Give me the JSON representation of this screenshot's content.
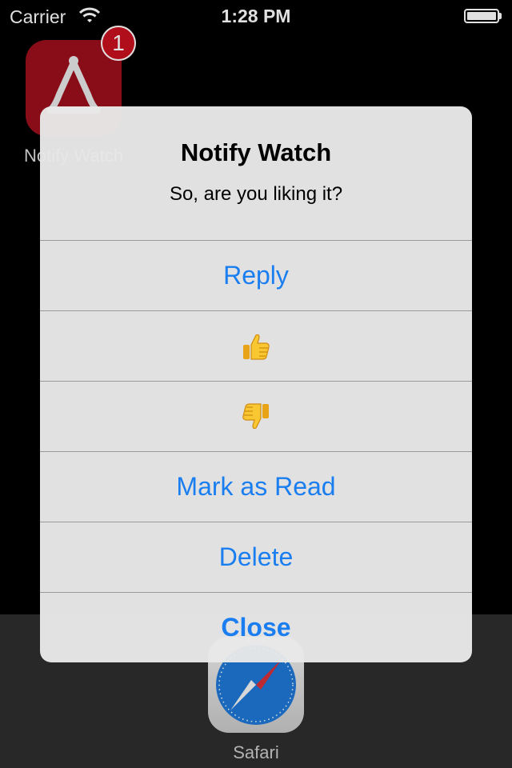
{
  "status_bar": {
    "carrier": "Carrier",
    "time": "1:28 PM"
  },
  "home": {
    "app_label": "Notify Watch",
    "badge_count": "1",
    "dock_app_label": "Safari"
  },
  "alert": {
    "title": "Notify Watch",
    "message": "So, are you liking it?",
    "buttons": [
      {
        "label": "Reply",
        "type": "text"
      },
      {
        "label": "👍",
        "type": "emoji",
        "icon": "thumbs-up-icon"
      },
      {
        "label": "👎",
        "type": "emoji",
        "icon": "thumbs-down-icon"
      },
      {
        "label": "Mark as Read",
        "type": "text"
      },
      {
        "label": "Delete",
        "type": "text"
      },
      {
        "label": "Close",
        "type": "text",
        "bold": true
      }
    ]
  },
  "colors": {
    "accent": "#1a7ef0",
    "app_icon": "#9c0f1d",
    "badge": "#c8101e"
  }
}
